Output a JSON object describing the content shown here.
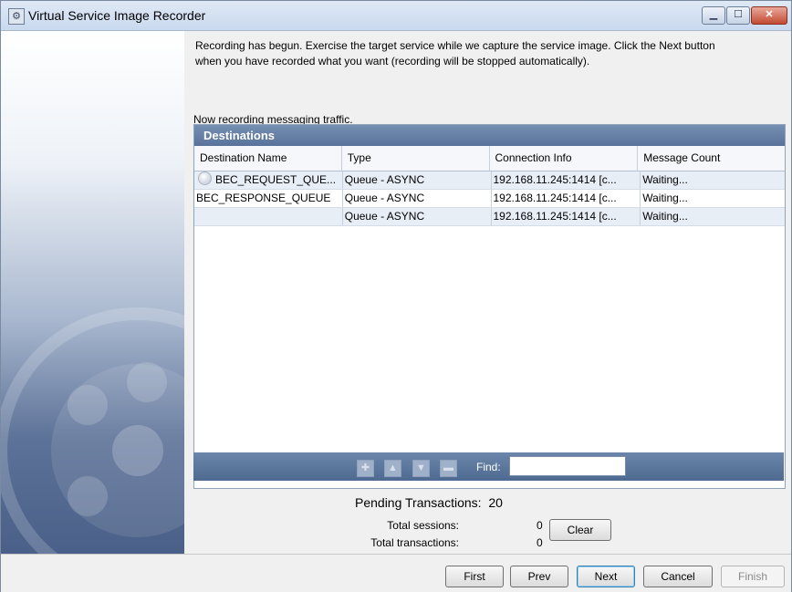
{
  "window": {
    "title": "Virtual Service Image Recorder"
  },
  "intro": {
    "line1": "Recording has begun.  Exercise the target service while we capture the service image.  Click the Next button",
    "line2": "when you have recorded what you want (recording will be stopped automatically)."
  },
  "status_text": "Now recording messaging traffic.",
  "destinations": {
    "title": "Destinations",
    "columns": [
      "Destination Name",
      "Type",
      "Connection Info",
      "Message Count"
    ],
    "rows": [
      {
        "name": "BEC_REQUEST_QUE...",
        "type": "Queue - ASYNC",
        "conn": "192.168.11.245:1414 [c...",
        "count": "Waiting..."
      },
      {
        "name": "BEC_RESPONSE_QUEUE",
        "type": "Queue - ASYNC",
        "conn": "192.168.11.245:1414 [c...",
        "count": "Waiting..."
      },
      {
        "name": "",
        "type": "Queue - ASYNC",
        "conn": "192.168.11.245:1414 [c...",
        "count": "Waiting..."
      }
    ]
  },
  "toolbar": {
    "find_label": "Find:",
    "find_value": ""
  },
  "pending": {
    "label": "Pending Transactions:",
    "value": "20"
  },
  "stats": {
    "sessions_label": "Total sessions:",
    "sessions_value": "0",
    "transactions_label": "Total transactions:",
    "transactions_value": "0",
    "clear_label": "Clear"
  },
  "nav": {
    "first": "First",
    "prev": "Prev",
    "next": "Next",
    "cancel": "Cancel",
    "finish": "Finish"
  }
}
